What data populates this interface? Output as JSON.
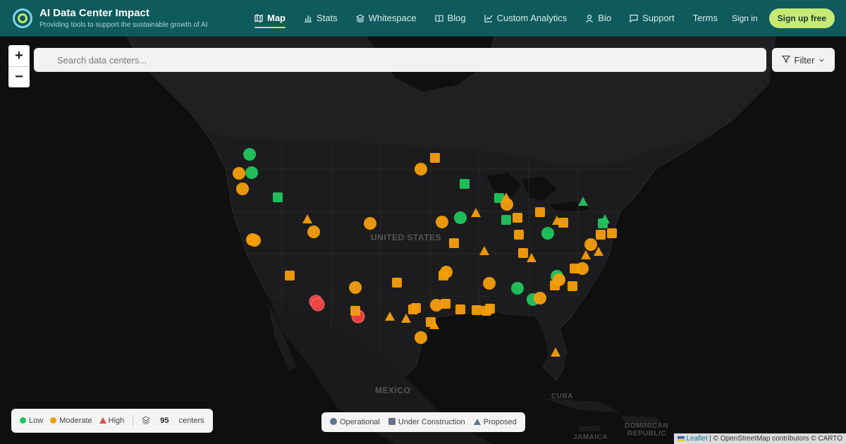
{
  "header": {
    "title": "AI Data Center Impact",
    "subtitle": "Providing tools to support the sustainable growth of AI",
    "nav": [
      {
        "label": "Map",
        "icon": "map-icon",
        "active": true
      },
      {
        "label": "Stats",
        "icon": "bar-chart-icon"
      },
      {
        "label": "Whitespace",
        "icon": "layers-icon"
      },
      {
        "label": "Blog",
        "icon": "book-icon"
      },
      {
        "label": "Custom Analytics",
        "icon": "line-chart-icon"
      },
      {
        "label": "Bio",
        "icon": "user-icon"
      },
      {
        "label": "Support",
        "icon": "chat-icon"
      },
      {
        "label": "Terms",
        "icon": ""
      }
    ],
    "signin_label": "Sign in",
    "signup_label": "Sign up free"
  },
  "map": {
    "zoom_in": "+",
    "zoom_out": "−",
    "search_placeholder": "Search data centers...",
    "filter_label": "Filter",
    "labels": {
      "country_us": "UNITED STATES",
      "country_mx": "MEXICO",
      "cuba": "CUBA",
      "dominican": "DOMINICAN",
      "republic": "REPUBLIC",
      "jamaica": "JAMAICA"
    }
  },
  "legend": {
    "low": "Low",
    "moderate": "Moderate",
    "high": "High",
    "count": "95",
    "count_suffix": "centers",
    "colors": {
      "low": "#22c55e",
      "moderate": "#f59e0b",
      "high": "#ef4444"
    }
  },
  "status_legend": {
    "operational": "Operational",
    "under_construction": "Under Construction",
    "proposed": "Proposed"
  },
  "attribution": {
    "leaflet": "Leaflet",
    "rest": "| © OpenStreetMap contributors © CARTO"
  }
}
